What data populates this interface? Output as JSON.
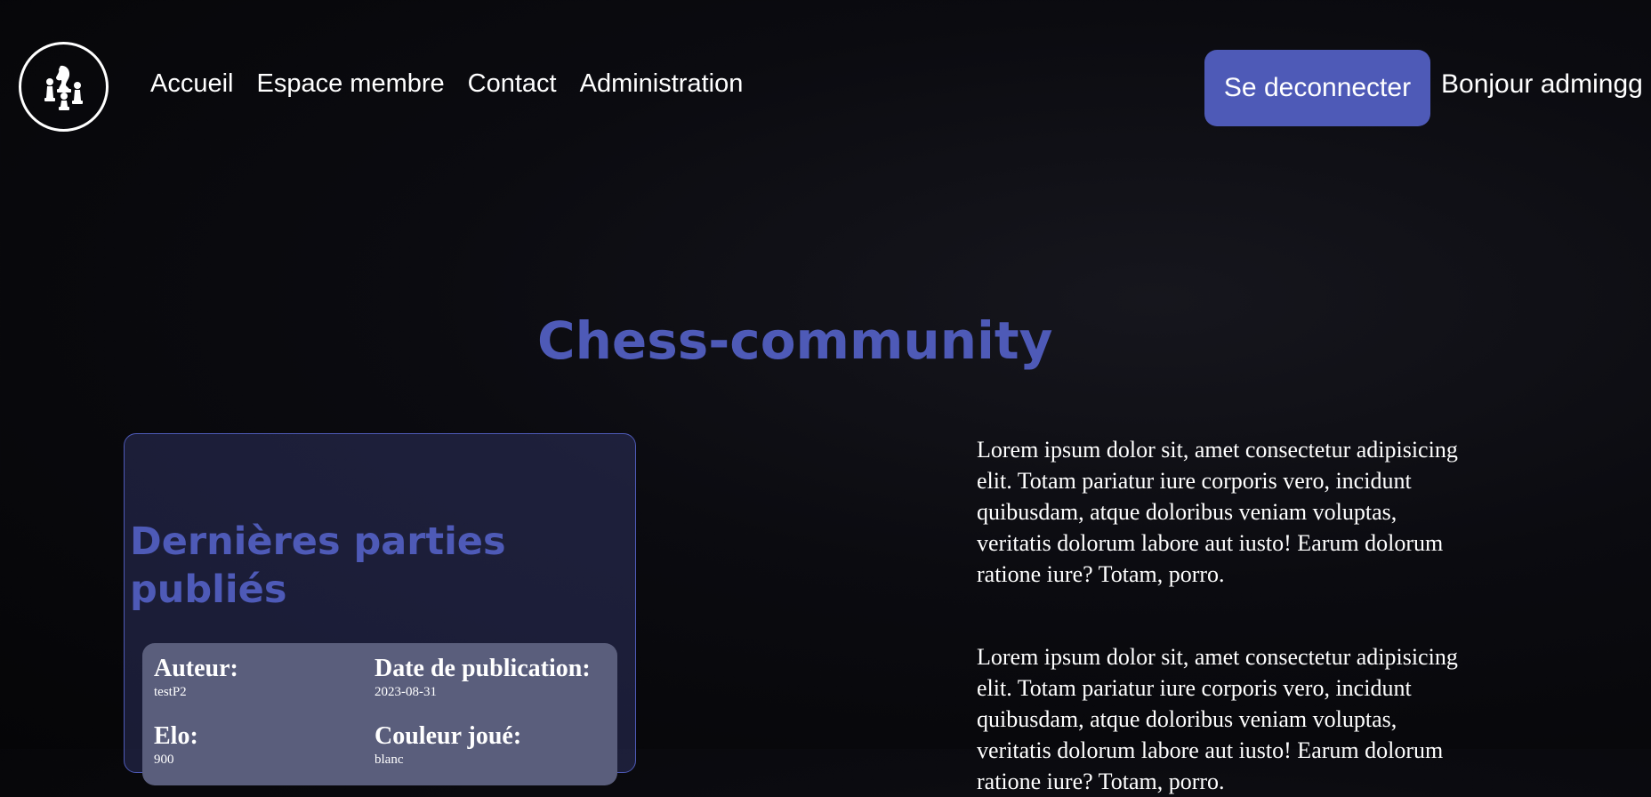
{
  "header": {
    "logo_icon": "chess-pieces-icon",
    "nav": [
      {
        "label": "Accueil"
      },
      {
        "label": "Espace membre"
      },
      {
        "label": "Contact"
      },
      {
        "label": "Administration"
      }
    ],
    "logout_label": "Se deconnecter",
    "greeting": "Bonjour admingg"
  },
  "main": {
    "title": "Chess-community",
    "games_panel": {
      "heading": "Dernières parties publiés",
      "game": {
        "author_label": "Auteur:",
        "author": "testP2",
        "date_label": "Date de publication:",
        "date": "2023-08-31",
        "elo_label": "Elo:",
        "elo": "900",
        "color_label": "Couleur joué:",
        "color": "blanc"
      }
    },
    "paragraphs": [
      "Lorem ipsum dolor sit, amet consectetur adipisicing elit. Totam pariatur iure corporis vero, incidunt quibusdam, atque doloribus veniam voluptas, veritatis dolorum labore aut iusto! Earum dolorum ratione iure? Totam, porro.",
      "Lorem ipsum dolor sit, amet consectetur adipisicing elit. Totam pariatur iure corporis vero, incidunt quibusdam, atque doloribus veniam voluptas, veritatis dolorum labore aut iusto! Earum dolorum ratione iure? Totam, porro."
    ]
  },
  "colors": {
    "accent": "#4e5ab7",
    "background": "#0b0b10",
    "card": "#5a5e7c"
  }
}
